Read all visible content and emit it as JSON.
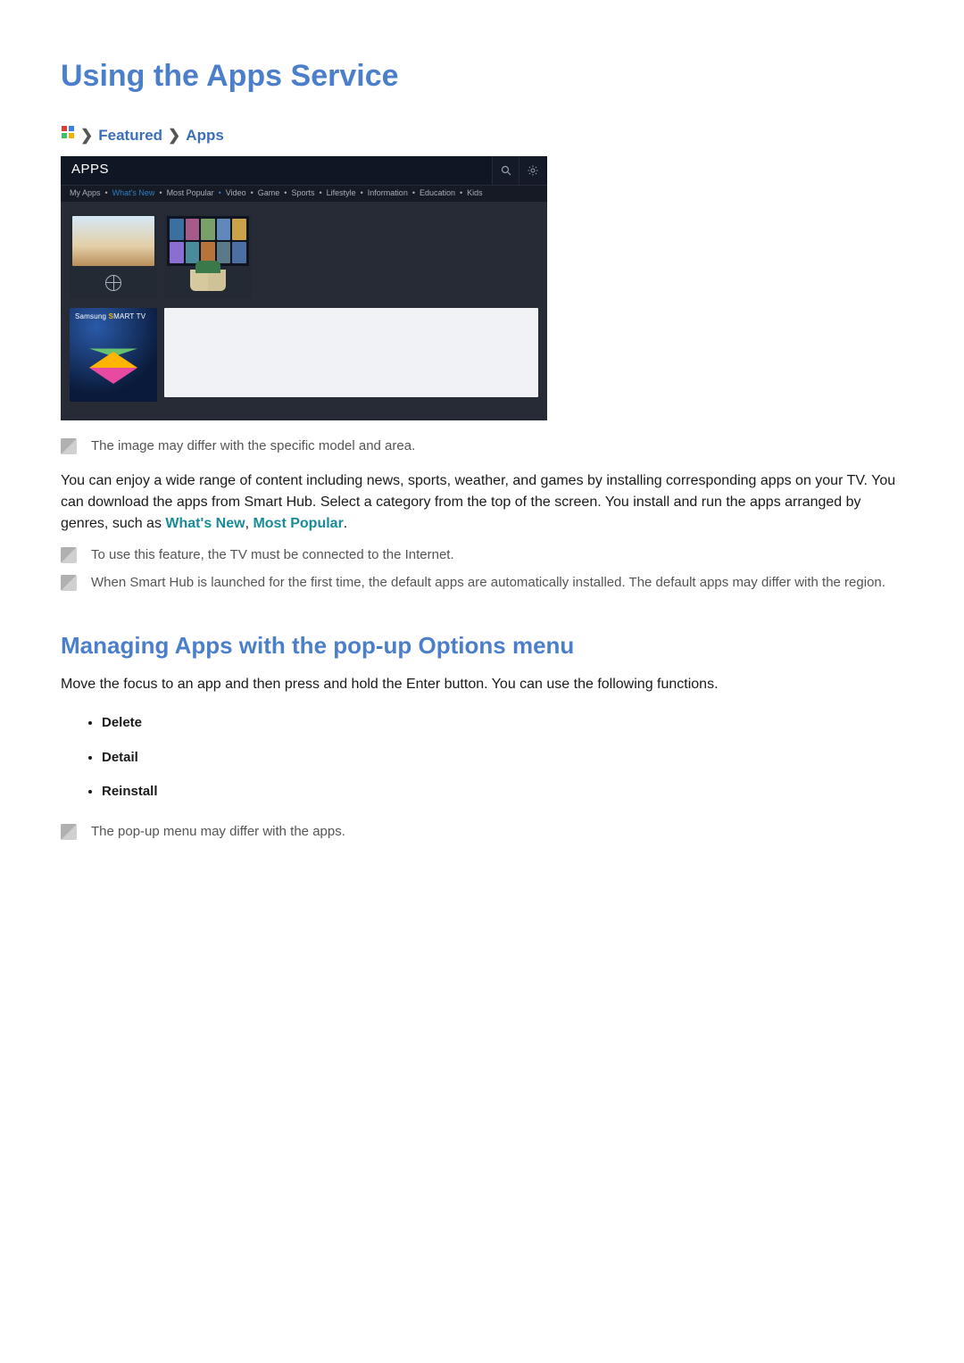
{
  "page": {
    "title": "Using the Apps Service"
  },
  "breadcrumb": {
    "featured": "Featured",
    "apps": "Apps"
  },
  "screenshot": {
    "title": "APPS",
    "tabs": {
      "my_apps": "My Apps",
      "whats_new": "What's New",
      "most_popular": "Most Popular",
      "video": "Video",
      "game": "Game",
      "sports": "Sports",
      "lifestyle": "Lifestyle",
      "information": "Information",
      "education": "Education",
      "kids": "Kids"
    },
    "smart_tv_label_prefix": "Samsung ",
    "smart_tv_label_s": "S",
    "smart_tv_label_rest": "MART TV"
  },
  "notes": {
    "image_differ": "The image may differ with the specific model and area.",
    "internet_required": "To use this feature, the TV must be connected to the Internet.",
    "default_apps": "When Smart Hub is launched for the first time, the default apps are automatically installed. The default apps may differ with the region.",
    "popup_differ": "The pop-up menu may differ with the apps."
  },
  "paragraphs": {
    "intro_part1": "You can enjoy a wide range of content including news, sports, weather, and games by installing corresponding apps on your TV. You can download the apps from Smart Hub. Select a category from the top of the screen. You install and run the apps arranged by genres, such as ",
    "intro_link1": "What's New",
    "intro_sep": ", ",
    "intro_link2": "Most Popular",
    "intro_end": ".",
    "managing_intro": "Move the focus to an app and then press and hold the Enter button. You can use the following functions."
  },
  "section2": {
    "title": "Managing Apps with the pop-up Options menu"
  },
  "functions": {
    "delete": "Delete",
    "detail": "Detail",
    "reinstall": "Reinstall"
  }
}
